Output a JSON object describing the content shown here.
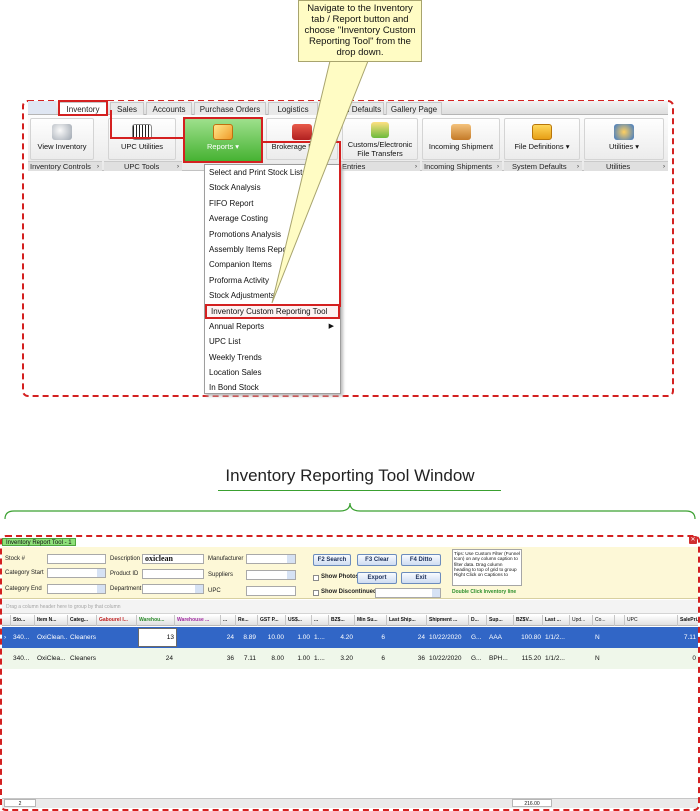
{
  "callout": {
    "text": "Navigate to the Inventory tab / Report button and choose \"Inventory Custom Reporting Tool\" from the drop down."
  },
  "ribbon_tabs": [
    {
      "label": "Inventory",
      "active": true
    },
    {
      "label": "Sales"
    },
    {
      "label": "Accounts"
    },
    {
      "label": "Purchase Orders"
    },
    {
      "label": "Logistics"
    },
    {
      "label": "System Defaults"
    },
    {
      "label": "Gallery Page"
    }
  ],
  "ribbon_buttons": {
    "view_inventory": "View Inventory",
    "upc_utilities": "UPC Utilities",
    "reports": "Reports",
    "brokerage": "Brokerage Utilities",
    "customs": "Customs/Electronic File Transfers",
    "incoming": "Incoming Shipment",
    "file_definitions": "File Definitions",
    "utilities": "Utilities"
  },
  "ribbon_groups": {
    "inventory_controls": "Inventory Controls",
    "upc_tools": "UPC Tools",
    "entries": "Entries",
    "incoming_shipments": "Incoming Shipments",
    "system_defaults": "System Defaults",
    "utilities": "Utilities"
  },
  "reports_menu": [
    {
      "label": "Select and Print Stock Lists"
    },
    {
      "label": "Stock Analysis"
    },
    {
      "label": "FIFO Report"
    },
    {
      "label": "Average Costing"
    },
    {
      "label": "Promotions Analysis"
    },
    {
      "label": "Assembly Items Report"
    },
    {
      "label": "Companion Items"
    },
    {
      "label": "Proforma Activity"
    },
    {
      "label": "Stock Adjustments"
    },
    {
      "label": "Inventory Custom Reporting Tool"
    },
    {
      "label": "Annual Reports"
    },
    {
      "label": "UPC List"
    },
    {
      "label": "Weekly Trends"
    },
    {
      "label": "Location Sales"
    },
    {
      "label": "In Bond Stock"
    }
  ],
  "section_title": "Inventory Reporting Tool Window",
  "window": {
    "tab_label": "Inventory Report Tool - 1",
    "filters": {
      "stock_label": "Stock #",
      "category_start_label": "Category Start",
      "category_end_label": "Category End",
      "description_label": "Description",
      "description_value": "oxiclean",
      "product_id_label": "Product ID",
      "department_label": "Department",
      "manufacturer_label": "Manufacturer",
      "suppliers_label": "Suppliers",
      "upc_label": "UPC"
    },
    "buttons": {
      "search": "F2 Search",
      "clear": "F3 Clear",
      "ditto": "F4 Ditto",
      "export": "Export",
      "exit": "Exit"
    },
    "checkboxes": {
      "show_photos": "Show Photos",
      "show_discontinued": "Show Discontinued"
    },
    "tips": "Tips: Use Custom Filter (Funnel Icon) on any column caption to filter data. Drag column heading to top of grid to group Right Click on Captions to",
    "double_click_hint": "Double Click Inventory line",
    "group_hint": "Drag a column header here to group by that column",
    "columns": [
      "Sto...",
      "Item N...",
      "Categ...",
      "Gabourel I...",
      "Warehou...",
      "Warehouse ...",
      "...",
      "Re...",
      "GST P...",
      "US$...",
      "...",
      "BZ$...",
      "Min Su...",
      "Last Ship...",
      "Shipment ...",
      "D...",
      "Sup...",
      "BZ$V...",
      "Last ...",
      "Upd...",
      "Co...",
      "",
      "UPC",
      "SalePri..."
    ],
    "rows": [
      [
        "340...",
        "OxiClean...",
        "Cleaners",
        "",
        "13",
        "",
        "24",
        "8.89",
        "10.00",
        "1.00",
        "1....",
        "4.20",
        "6",
        "24",
        "10/22/2020",
        "G...",
        "AAA",
        "100.80",
        "1/1/2...",
        "",
        "N",
        "",
        "",
        "7.11"
      ],
      [
        "340...",
        "OxiClea...",
        "Cleaners",
        "",
        "24",
        "",
        "36",
        "7.11",
        "8.00",
        "1.00",
        "1....",
        "3.20",
        "6",
        "36",
        "10/22/2020",
        "G...",
        "BPH...",
        "115.20",
        "1/1/2...",
        "",
        "N",
        "",
        "",
        "0"
      ]
    ],
    "status": {
      "count": "2",
      "total": "216.00"
    }
  },
  "colors": {
    "highlight_red": "#d42020",
    "accent_green": "#3aa030",
    "selected_row": "#3166c6"
  }
}
